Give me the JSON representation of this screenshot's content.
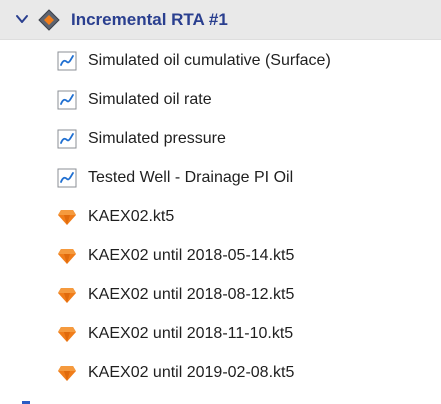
{
  "tree": {
    "header": {
      "label": "Incremental RTA #1",
      "expand_icon": "chevron-down-icon",
      "node_icon": "diamond-folder-icon"
    },
    "items": [
      {
        "label": "Simulated oil cumulative (Surface)",
        "icon": "plot-icon"
      },
      {
        "label": "Simulated oil rate",
        "icon": "plot-icon"
      },
      {
        "label": "Simulated pressure",
        "icon": "plot-icon"
      },
      {
        "label": "Tested Well - Drainage PI Oil",
        "icon": "plot-icon"
      },
      {
        "label": "KAEX02.kt5",
        "icon": "orange-gem-icon"
      },
      {
        "label": "KAEX02 until 2018-05-14.kt5",
        "icon": "orange-gem-icon"
      },
      {
        "label": "KAEX02 until 2018-08-12.kt5",
        "icon": "orange-gem-icon"
      },
      {
        "label": "KAEX02 until 2018-11-10.kt5",
        "icon": "orange-gem-icon"
      },
      {
        "label": "KAEX02 until 2019-02-08.kt5",
        "icon": "orange-gem-icon"
      }
    ]
  },
  "colors": {
    "header_bg": "#e9e9e9",
    "header_text": "#2a3f8f",
    "plot_icon_stroke": "#1f6fd1",
    "gem_orange": "#f07d1a"
  }
}
